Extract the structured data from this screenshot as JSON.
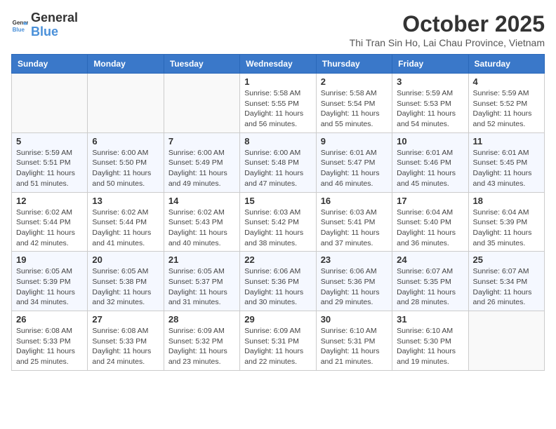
{
  "logo": {
    "general": "General",
    "blue": "Blue"
  },
  "header": {
    "month": "October 2025",
    "location": "Thi Tran Sin Ho, Lai Chau Province, Vietnam"
  },
  "weekdays": [
    "Sunday",
    "Monday",
    "Tuesday",
    "Wednesday",
    "Thursday",
    "Friday",
    "Saturday"
  ],
  "weeks": [
    [
      {
        "day": "",
        "info": ""
      },
      {
        "day": "",
        "info": ""
      },
      {
        "day": "",
        "info": ""
      },
      {
        "day": "1",
        "info": "Sunrise: 5:58 AM\nSunset: 5:55 PM\nDaylight: 11 hours\nand 56 minutes."
      },
      {
        "day": "2",
        "info": "Sunrise: 5:58 AM\nSunset: 5:54 PM\nDaylight: 11 hours\nand 55 minutes."
      },
      {
        "day": "3",
        "info": "Sunrise: 5:59 AM\nSunset: 5:53 PM\nDaylight: 11 hours\nand 54 minutes."
      },
      {
        "day": "4",
        "info": "Sunrise: 5:59 AM\nSunset: 5:52 PM\nDaylight: 11 hours\nand 52 minutes."
      }
    ],
    [
      {
        "day": "5",
        "info": "Sunrise: 5:59 AM\nSunset: 5:51 PM\nDaylight: 11 hours\nand 51 minutes."
      },
      {
        "day": "6",
        "info": "Sunrise: 6:00 AM\nSunset: 5:50 PM\nDaylight: 11 hours\nand 50 minutes."
      },
      {
        "day": "7",
        "info": "Sunrise: 6:00 AM\nSunset: 5:49 PM\nDaylight: 11 hours\nand 49 minutes."
      },
      {
        "day": "8",
        "info": "Sunrise: 6:00 AM\nSunset: 5:48 PM\nDaylight: 11 hours\nand 47 minutes."
      },
      {
        "day": "9",
        "info": "Sunrise: 6:01 AM\nSunset: 5:47 PM\nDaylight: 11 hours\nand 46 minutes."
      },
      {
        "day": "10",
        "info": "Sunrise: 6:01 AM\nSunset: 5:46 PM\nDaylight: 11 hours\nand 45 minutes."
      },
      {
        "day": "11",
        "info": "Sunrise: 6:01 AM\nSunset: 5:45 PM\nDaylight: 11 hours\nand 43 minutes."
      }
    ],
    [
      {
        "day": "12",
        "info": "Sunrise: 6:02 AM\nSunset: 5:44 PM\nDaylight: 11 hours\nand 42 minutes."
      },
      {
        "day": "13",
        "info": "Sunrise: 6:02 AM\nSunset: 5:44 PM\nDaylight: 11 hours\nand 41 minutes."
      },
      {
        "day": "14",
        "info": "Sunrise: 6:02 AM\nSunset: 5:43 PM\nDaylight: 11 hours\nand 40 minutes."
      },
      {
        "day": "15",
        "info": "Sunrise: 6:03 AM\nSunset: 5:42 PM\nDaylight: 11 hours\nand 38 minutes."
      },
      {
        "day": "16",
        "info": "Sunrise: 6:03 AM\nSunset: 5:41 PM\nDaylight: 11 hours\nand 37 minutes."
      },
      {
        "day": "17",
        "info": "Sunrise: 6:04 AM\nSunset: 5:40 PM\nDaylight: 11 hours\nand 36 minutes."
      },
      {
        "day": "18",
        "info": "Sunrise: 6:04 AM\nSunset: 5:39 PM\nDaylight: 11 hours\nand 35 minutes."
      }
    ],
    [
      {
        "day": "19",
        "info": "Sunrise: 6:05 AM\nSunset: 5:39 PM\nDaylight: 11 hours\nand 34 minutes."
      },
      {
        "day": "20",
        "info": "Sunrise: 6:05 AM\nSunset: 5:38 PM\nDaylight: 11 hours\nand 32 minutes."
      },
      {
        "day": "21",
        "info": "Sunrise: 6:05 AM\nSunset: 5:37 PM\nDaylight: 11 hours\nand 31 minutes."
      },
      {
        "day": "22",
        "info": "Sunrise: 6:06 AM\nSunset: 5:36 PM\nDaylight: 11 hours\nand 30 minutes."
      },
      {
        "day": "23",
        "info": "Sunrise: 6:06 AM\nSunset: 5:36 PM\nDaylight: 11 hours\nand 29 minutes."
      },
      {
        "day": "24",
        "info": "Sunrise: 6:07 AM\nSunset: 5:35 PM\nDaylight: 11 hours\nand 28 minutes."
      },
      {
        "day": "25",
        "info": "Sunrise: 6:07 AM\nSunset: 5:34 PM\nDaylight: 11 hours\nand 26 minutes."
      }
    ],
    [
      {
        "day": "26",
        "info": "Sunrise: 6:08 AM\nSunset: 5:33 PM\nDaylight: 11 hours\nand 25 minutes."
      },
      {
        "day": "27",
        "info": "Sunrise: 6:08 AM\nSunset: 5:33 PM\nDaylight: 11 hours\nand 24 minutes."
      },
      {
        "day": "28",
        "info": "Sunrise: 6:09 AM\nSunset: 5:32 PM\nDaylight: 11 hours\nand 23 minutes."
      },
      {
        "day": "29",
        "info": "Sunrise: 6:09 AM\nSunset: 5:31 PM\nDaylight: 11 hours\nand 22 minutes."
      },
      {
        "day": "30",
        "info": "Sunrise: 6:10 AM\nSunset: 5:31 PM\nDaylight: 11 hours\nand 21 minutes."
      },
      {
        "day": "31",
        "info": "Sunrise: 6:10 AM\nSunset: 5:30 PM\nDaylight: 11 hours\nand 19 minutes."
      },
      {
        "day": "",
        "info": ""
      }
    ]
  ]
}
